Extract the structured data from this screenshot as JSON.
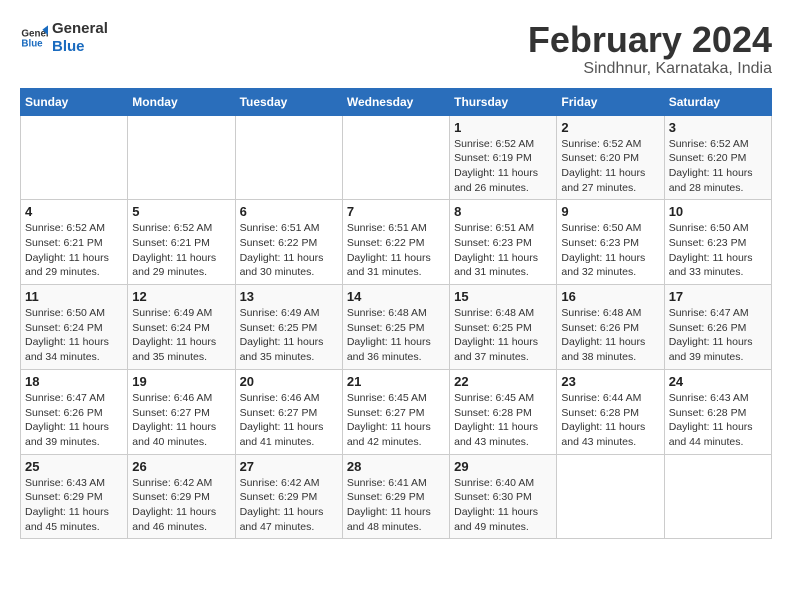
{
  "logo": {
    "line1": "General",
    "line2": "Blue"
  },
  "title": "February 2024",
  "location": "Sindhnur, Karnataka, India",
  "days_of_week": [
    "Sunday",
    "Monday",
    "Tuesday",
    "Wednesday",
    "Thursday",
    "Friday",
    "Saturday"
  ],
  "weeks": [
    [
      {
        "day": "",
        "info": ""
      },
      {
        "day": "",
        "info": ""
      },
      {
        "day": "",
        "info": ""
      },
      {
        "day": "",
        "info": ""
      },
      {
        "day": "1",
        "info": "Sunrise: 6:52 AM\nSunset: 6:19 PM\nDaylight: 11 hours and 26 minutes."
      },
      {
        "day": "2",
        "info": "Sunrise: 6:52 AM\nSunset: 6:20 PM\nDaylight: 11 hours and 27 minutes."
      },
      {
        "day": "3",
        "info": "Sunrise: 6:52 AM\nSunset: 6:20 PM\nDaylight: 11 hours and 28 minutes."
      }
    ],
    [
      {
        "day": "4",
        "info": "Sunrise: 6:52 AM\nSunset: 6:21 PM\nDaylight: 11 hours and 29 minutes."
      },
      {
        "day": "5",
        "info": "Sunrise: 6:52 AM\nSunset: 6:21 PM\nDaylight: 11 hours and 29 minutes."
      },
      {
        "day": "6",
        "info": "Sunrise: 6:51 AM\nSunset: 6:22 PM\nDaylight: 11 hours and 30 minutes."
      },
      {
        "day": "7",
        "info": "Sunrise: 6:51 AM\nSunset: 6:22 PM\nDaylight: 11 hours and 31 minutes."
      },
      {
        "day": "8",
        "info": "Sunrise: 6:51 AM\nSunset: 6:23 PM\nDaylight: 11 hours and 31 minutes."
      },
      {
        "day": "9",
        "info": "Sunrise: 6:50 AM\nSunset: 6:23 PM\nDaylight: 11 hours and 32 minutes."
      },
      {
        "day": "10",
        "info": "Sunrise: 6:50 AM\nSunset: 6:23 PM\nDaylight: 11 hours and 33 minutes."
      }
    ],
    [
      {
        "day": "11",
        "info": "Sunrise: 6:50 AM\nSunset: 6:24 PM\nDaylight: 11 hours and 34 minutes."
      },
      {
        "day": "12",
        "info": "Sunrise: 6:49 AM\nSunset: 6:24 PM\nDaylight: 11 hours and 35 minutes."
      },
      {
        "day": "13",
        "info": "Sunrise: 6:49 AM\nSunset: 6:25 PM\nDaylight: 11 hours and 35 minutes."
      },
      {
        "day": "14",
        "info": "Sunrise: 6:48 AM\nSunset: 6:25 PM\nDaylight: 11 hours and 36 minutes."
      },
      {
        "day": "15",
        "info": "Sunrise: 6:48 AM\nSunset: 6:25 PM\nDaylight: 11 hours and 37 minutes."
      },
      {
        "day": "16",
        "info": "Sunrise: 6:48 AM\nSunset: 6:26 PM\nDaylight: 11 hours and 38 minutes."
      },
      {
        "day": "17",
        "info": "Sunrise: 6:47 AM\nSunset: 6:26 PM\nDaylight: 11 hours and 39 minutes."
      }
    ],
    [
      {
        "day": "18",
        "info": "Sunrise: 6:47 AM\nSunset: 6:26 PM\nDaylight: 11 hours and 39 minutes."
      },
      {
        "day": "19",
        "info": "Sunrise: 6:46 AM\nSunset: 6:27 PM\nDaylight: 11 hours and 40 minutes."
      },
      {
        "day": "20",
        "info": "Sunrise: 6:46 AM\nSunset: 6:27 PM\nDaylight: 11 hours and 41 minutes."
      },
      {
        "day": "21",
        "info": "Sunrise: 6:45 AM\nSunset: 6:27 PM\nDaylight: 11 hours and 42 minutes."
      },
      {
        "day": "22",
        "info": "Sunrise: 6:45 AM\nSunset: 6:28 PM\nDaylight: 11 hours and 43 minutes."
      },
      {
        "day": "23",
        "info": "Sunrise: 6:44 AM\nSunset: 6:28 PM\nDaylight: 11 hours and 43 minutes."
      },
      {
        "day": "24",
        "info": "Sunrise: 6:43 AM\nSunset: 6:28 PM\nDaylight: 11 hours and 44 minutes."
      }
    ],
    [
      {
        "day": "25",
        "info": "Sunrise: 6:43 AM\nSunset: 6:29 PM\nDaylight: 11 hours and 45 minutes."
      },
      {
        "day": "26",
        "info": "Sunrise: 6:42 AM\nSunset: 6:29 PM\nDaylight: 11 hours and 46 minutes."
      },
      {
        "day": "27",
        "info": "Sunrise: 6:42 AM\nSunset: 6:29 PM\nDaylight: 11 hours and 47 minutes."
      },
      {
        "day": "28",
        "info": "Sunrise: 6:41 AM\nSunset: 6:29 PM\nDaylight: 11 hours and 48 minutes."
      },
      {
        "day": "29",
        "info": "Sunrise: 6:40 AM\nSunset: 6:30 PM\nDaylight: 11 hours and 49 minutes."
      },
      {
        "day": "",
        "info": ""
      },
      {
        "day": "",
        "info": ""
      }
    ]
  ]
}
